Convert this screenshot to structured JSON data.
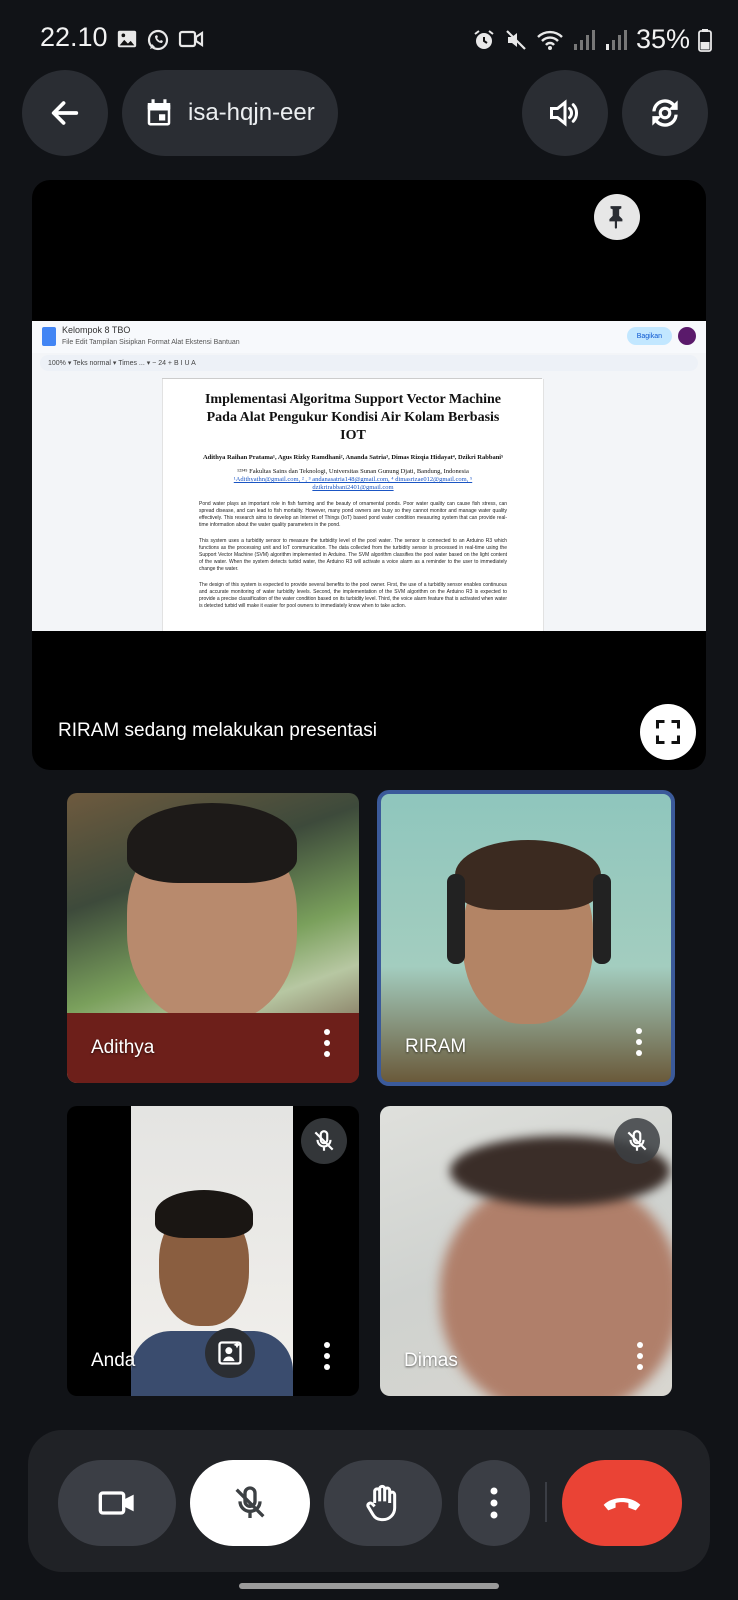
{
  "status_bar": {
    "time": "22.10",
    "battery": "35%"
  },
  "top_bar": {
    "meeting_code": "isa-hqjn-eer",
    "icons": [
      "arrow-back-icon",
      "calendar-icon",
      "speaker-icon",
      "flip-camera-icon"
    ]
  },
  "presentation": {
    "label": "RIRAM sedang melakukan presentasi",
    "doc": {
      "name": "Kelompok 8 TBO",
      "menu": "File  Edit  Tampilan  Sisipkan  Format  Alat  Ekstensi  Bantuan",
      "share": "Bagikan",
      "toolbar": "100% ▾    Teks normal ▾    Times ... ▾    − 24 +    B  I  U  A",
      "title": "Implementasi Algoritma Support Vector Machine Pada Alat Pengukur Kondisi Air Kolam Berbasis IOT",
      "authors": "Adithya Raihan Pratama¹, Agus Rizky Ramdhani², Ananda Satria³, Dimas Rizqia Hidayat⁴, Dzikri Rabbani⁵",
      "affiliation": "¹²³⁴⁵ Fakultas Sains dan Teknologi, Universitas Sunan Gunung Djati, Bandung, Indonesia",
      "emails": "¹Adithyathn@gmail.com, ²                         , ³ andanasatria148@gmail.com, ⁴ dimasrizae012@gmail.com, ⁵ dzikrirabbani2401@gmail.com",
      "para1": "Pond water plays an important role in fish farming and the beauty of ornamental ponds. Poor water quality can cause fish stress, can spread disease, and can lead to fish mortality. However, many pond owners are busy so they cannot monitor and manage water quality effectively. This research aims to develop an Internet of Things (IoT) based pond water condition measuring system that can provide real-time information about the water quality parameters in the pond.",
      "para2": "This system uses a turbidity sensor to measure the turbidity level of the pool water. The sensor is connected to an Arduino R3 which functions as the processing unit and IoT communication. The data collected from the turbidity sensor is processed in real-time using the Support Vector Machine (SVM) algorithm implemented in Arduino. The SVM algorithm classifies the pool water based on the light content of the water. When the system detects turbid water, the Arduino R3 will activate a voice alarm as a reminder to the user to immediately change the water.",
      "para3": "The design of this system is expected to provide several benefits to the pool owner. First, the use of a turbidity sensor enables continuous and accurate monitoring of water turbidity levels. Second, the implementation of the SVM algorithm on the Arduino R3 is expected to provide a precise classification of the water condition based on its turbidity level. Third, the voice alarm feature that is activated when water is detected turbid will make it easier for pool owners to immediately know when to take action."
    }
  },
  "participants": [
    {
      "name": "Adithya",
      "muted": false,
      "active": false
    },
    {
      "name": "RIRAM",
      "muted": false,
      "active": true
    },
    {
      "name": "Anda",
      "muted": true,
      "active": false
    },
    {
      "name": "Dimas",
      "muted": true,
      "active": false
    }
  ],
  "controls": {
    "camera": "camera-icon",
    "mic": "mic-off-icon",
    "raise_hand": "hand-icon",
    "more": "more-vert-icon",
    "end_call": "end-call-icon"
  },
  "colors": {
    "background": "#111317",
    "end_call": "#ea4335",
    "active_border": "#3b5a9a"
  }
}
